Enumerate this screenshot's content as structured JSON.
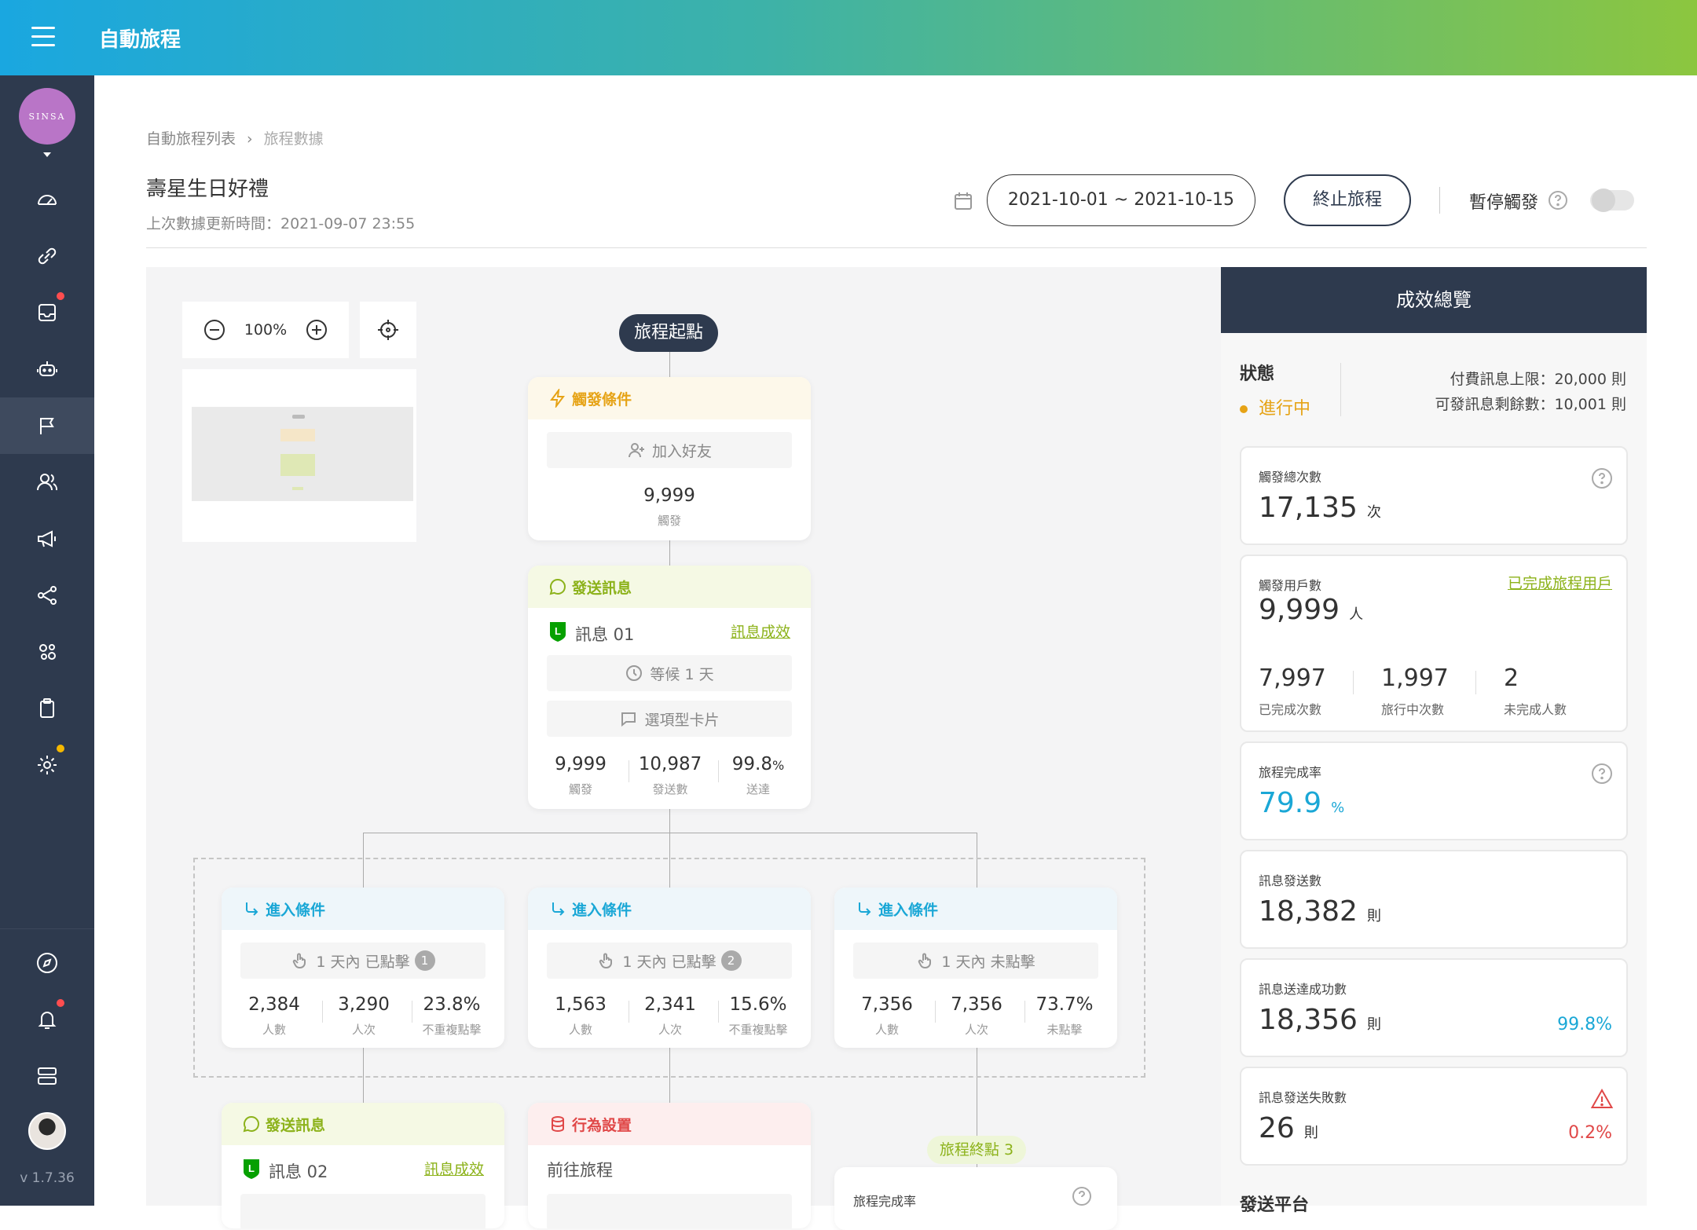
{
  "app": {
    "title": "自動旅程",
    "version": "v 1.7.36",
    "logo_text": "SINSA"
  },
  "breadcrumb": {
    "parent": "自動旅程列表",
    "current": "旅程數據"
  },
  "page": {
    "title": "壽星生日好禮",
    "updated": "上次數據更新時間：2021-09-07 23:55"
  },
  "toolbar": {
    "date_range": "2021-10-01 ~ 2021-10-15",
    "stop_label": "終止旅程",
    "pause_label": "暫停觸發",
    "pause_enabled": false
  },
  "canvas": {
    "zoom": "100%"
  },
  "flow": {
    "start": "旅程起點",
    "trigger": {
      "header": "觸發條件",
      "condition": "加入好友",
      "value": "9,999",
      "value_label": "觸發"
    },
    "message1": {
      "header": "發送訊息",
      "name": "訊息 01",
      "link": "訊息成效",
      "wait": "等候 1 天",
      "card_type": "選項型卡片",
      "stats": [
        {
          "value": "9,999",
          "label": "觸發"
        },
        {
          "value": "10,987",
          "label": "發送數"
        },
        {
          "value": "99.8",
          "unit": "%",
          "label": "送達"
        }
      ]
    },
    "branches": [
      {
        "header": "進入條件",
        "condition": "1 天內 已點擊",
        "badge": "1",
        "stats": [
          {
            "value": "2,384",
            "label": "人數"
          },
          {
            "value": "3,290",
            "label": "人次"
          },
          {
            "value": "23.8%",
            "label": "不重複點擊"
          }
        ]
      },
      {
        "header": "進入條件",
        "condition": "1 天內 已點擊",
        "badge": "2",
        "stats": [
          {
            "value": "1,563",
            "label": "人數"
          },
          {
            "value": "2,341",
            "label": "人次"
          },
          {
            "value": "15.6%",
            "label": "不重複點擊"
          }
        ]
      },
      {
        "header": "進入條件",
        "condition": "1 天內 未點擊",
        "badge": "",
        "stats": [
          {
            "value": "7,356",
            "label": "人數"
          },
          {
            "value": "7,356",
            "label": "人次"
          },
          {
            "value": "73.7%",
            "label": "未點擊"
          }
        ]
      }
    ],
    "message2": {
      "header": "發送訊息",
      "name": "訊息 02",
      "link": "訊息成效"
    },
    "action": {
      "header": "行為設置",
      "label": "前往旅程"
    },
    "end": {
      "pill": "旅程終點 3",
      "label": "旅程完成率"
    }
  },
  "perf": {
    "title": "成效總覽",
    "status_label": "狀態",
    "status_value": "進行中",
    "quota": "付費訊息上限：20,000 則",
    "remaining": "可發訊息剩餘數：10,001 則",
    "trigger_total": {
      "label": "觸發總次數",
      "value": "17,135",
      "unit": "次"
    },
    "trigger_users": {
      "label": "觸發用戶數",
      "value": "9,999",
      "unit": "人",
      "link": "已完成旅程用戶",
      "breakdown": [
        {
          "value": "7,997",
          "label": "已完成次數"
        },
        {
          "value": "1,997",
          "label": "旅行中次數"
        },
        {
          "value": "2",
          "label": "未完成人數"
        }
      ]
    },
    "completion": {
      "label": "旅程完成率",
      "value": "79.9",
      "unit": "%"
    },
    "sent": {
      "label": "訊息發送數",
      "value": "18,382",
      "unit": "則"
    },
    "delivered": {
      "label": "訊息送達成功數",
      "value": "18,356",
      "unit": "則",
      "pct": "99.8%"
    },
    "failed": {
      "label": "訊息發送失敗數",
      "value": "26",
      "unit": "則",
      "pct": "0.2%"
    },
    "platform_label": "發送平台"
  },
  "colors": {
    "accent_blue": "#1aa7d6",
    "accent_green": "#8cb21a",
    "warning": "#e6a316",
    "danger": "#e04848",
    "nav_bg": "#2e3a4e"
  }
}
